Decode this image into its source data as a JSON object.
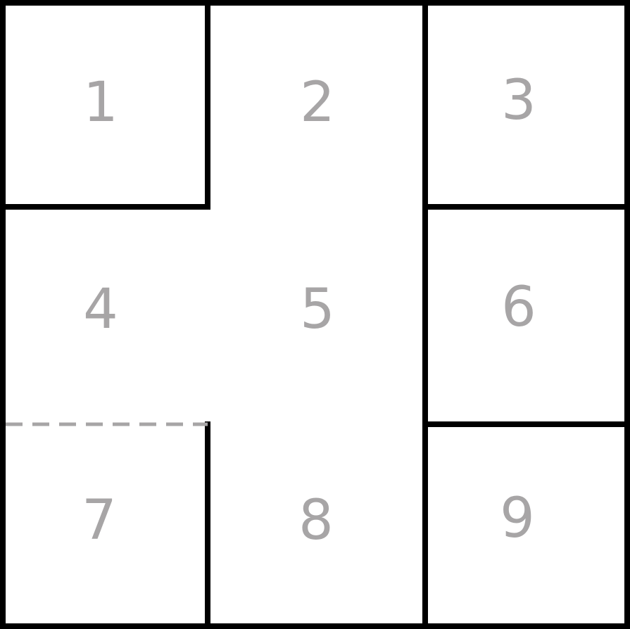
{
  "grid": {
    "cells": [
      {
        "id": "cell-1",
        "label": "1"
      },
      {
        "id": "cell-2",
        "label": "2"
      },
      {
        "id": "cell-3",
        "label": "3"
      },
      {
        "id": "cell-4",
        "label": "4"
      },
      {
        "id": "cell-5",
        "label": "5"
      },
      {
        "id": "cell-6",
        "label": "6"
      },
      {
        "id": "cell-7",
        "label": "7"
      },
      {
        "id": "cell-8",
        "label": "8"
      },
      {
        "id": "cell-9",
        "label": "9"
      }
    ]
  },
  "colors": {
    "wall": "#000000",
    "label": "#a7a5a6",
    "dashed_wall": "#a7a5a6",
    "background": "#ffffff"
  }
}
